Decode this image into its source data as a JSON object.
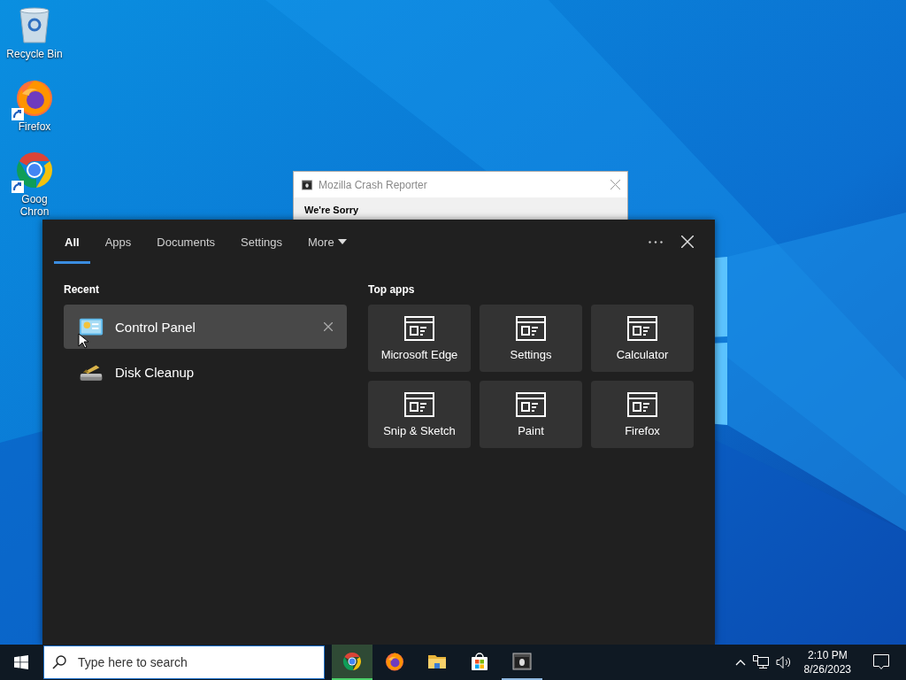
{
  "desktop": {
    "icons": [
      {
        "kind": "recycle-bin",
        "label": "Recycle Bin",
        "shortcut": false
      },
      {
        "kind": "firefox",
        "label": "Firefox",
        "shortcut": true
      },
      {
        "kind": "chrome",
        "label": "Goog\nChron",
        "shortcut": true
      }
    ]
  },
  "crash_window": {
    "title": "Mozilla Crash Reporter",
    "heading": "We're Sorry"
  },
  "search_panel": {
    "tabs": [
      {
        "label": "All",
        "selected": true,
        "dropdown": false
      },
      {
        "label": "Apps",
        "selected": false,
        "dropdown": false
      },
      {
        "label": "Documents",
        "selected": false,
        "dropdown": false
      },
      {
        "label": "Settings",
        "selected": false,
        "dropdown": false
      },
      {
        "label": "More",
        "selected": false,
        "dropdown": true
      }
    ],
    "recent": {
      "heading": "Recent",
      "items": [
        {
          "kind": "control-panel",
          "label": "Control Panel",
          "hovered": true
        },
        {
          "kind": "disk-cleanup",
          "label": "Disk Cleanup",
          "hovered": false
        }
      ]
    },
    "top_apps": {
      "heading": "Top apps",
      "items": [
        {
          "label": "Microsoft Edge"
        },
        {
          "label": "Settings"
        },
        {
          "label": "Calculator"
        },
        {
          "label": "Snip & Sketch"
        },
        {
          "label": "Paint"
        },
        {
          "label": "Firefox"
        }
      ]
    }
  },
  "taskbar": {
    "search": {
      "placeholder": "Type here to search"
    },
    "apps": [
      {
        "kind": "chrome",
        "active": true,
        "running": true
      },
      {
        "kind": "firefox",
        "active": false,
        "running": false
      },
      {
        "kind": "folder",
        "active": false,
        "running": false
      },
      {
        "kind": "store",
        "active": false,
        "running": false
      },
      {
        "kind": "crash-reporter",
        "active": false,
        "running": true
      }
    ],
    "clock": {
      "time": "2:10 PM",
      "date": "8/26/2023"
    }
  }
}
